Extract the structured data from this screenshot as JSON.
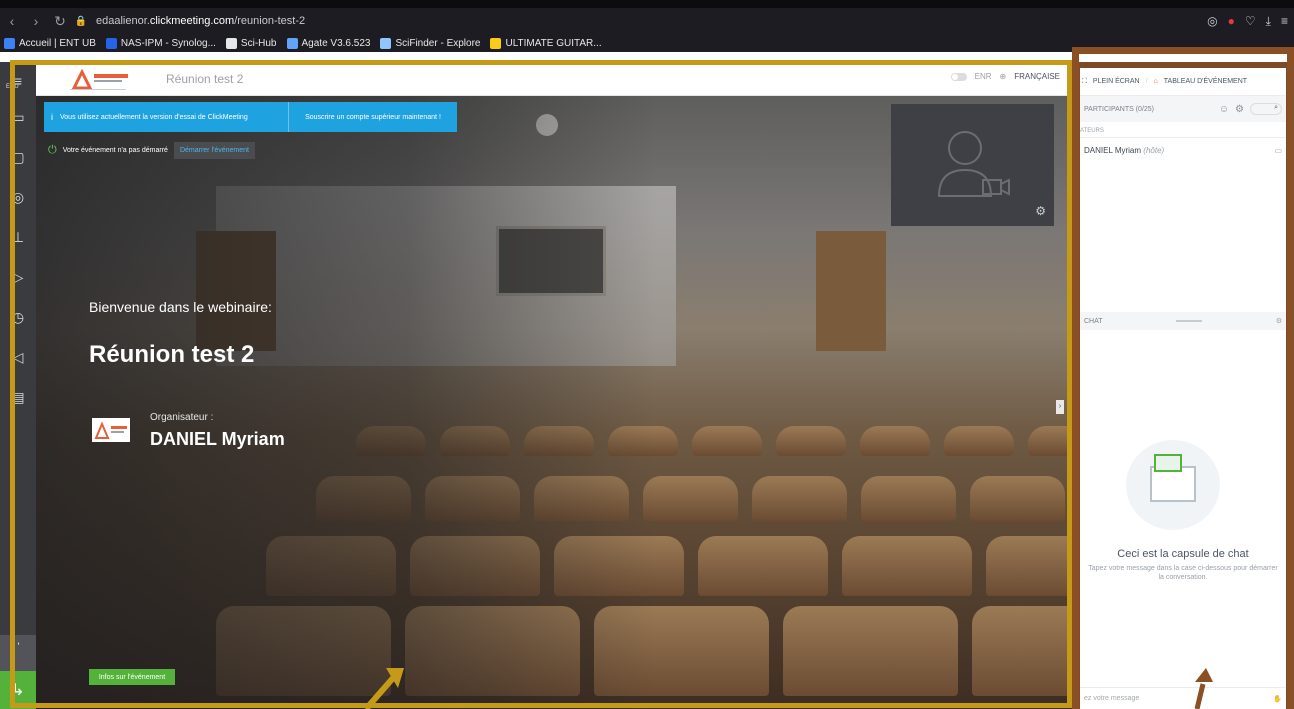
{
  "browser": {
    "url_prefix": "edaalienor.",
    "url_domain": "clickmeeting.com",
    "url_path": "/reunion-test-2",
    "bookmarks": [
      {
        "label": "Accueil | ENT UB",
        "color": "#3b82f6"
      },
      {
        "label": "NAS-IPM - Synolog...",
        "color": "#2563eb"
      },
      {
        "label": "Sci-Hub",
        "color": "#e5e7eb"
      },
      {
        "label": "Agate V3.6.523",
        "color": "#60a5fa"
      },
      {
        "label": "SciFinder - Explore",
        "color": "#93c5fd"
      },
      {
        "label": "ULTIMATE GUITAR...",
        "color": "#facc15"
      }
    ]
  },
  "sidebar": {
    "menu_label": "ENU",
    "icons": [
      "video-icon",
      "whiteboard-icon",
      "compass-icon",
      "presenter-icon",
      "share-icon",
      "poll-icon",
      "megaphone-icon",
      "document-icon"
    ]
  },
  "header": {
    "event_title": "Réunion test 2",
    "language": "FRANÇAISE",
    "rec_label": "ENR"
  },
  "stage": {
    "notice_text": "Vous utilisez actuellement la version d'essai de ClickMeeting",
    "notice_button": "Souscrire un compte supérieur maintenant !",
    "status_text": "Votre événement n'a pas démarré",
    "start_link": "Démarrer l'événement",
    "welcome": "Bienvenue dans le webinaire:",
    "title": "Réunion test 2",
    "organizer_label": "Organisateur :",
    "organizer_name": "DANIEL Myriam",
    "info_button": "Infos sur l'événement"
  },
  "right_panel": {
    "fullscreen": "PLEIN ÉCRAN",
    "dashboard": "TABLEAU D'ÉVÉNEMENT",
    "participants": "PARTICIPANTS (0/25)",
    "group": "ATEURS",
    "participant_name": "DANIEL Myriam",
    "participant_role": "(hôte)",
    "chat_label": "CHAT",
    "chat_title": "Ceci est la capsule de chat",
    "chat_sub": "Tapez votre message dans la case ci-dessous pour démarrer la conversation.",
    "chat_placeholder": "ez votre message"
  },
  "colors": {
    "accent_blue": "#1fa3e0",
    "green": "#54b23a",
    "frame_gold": "#c59a17",
    "frame_brown": "#8a4f22"
  }
}
